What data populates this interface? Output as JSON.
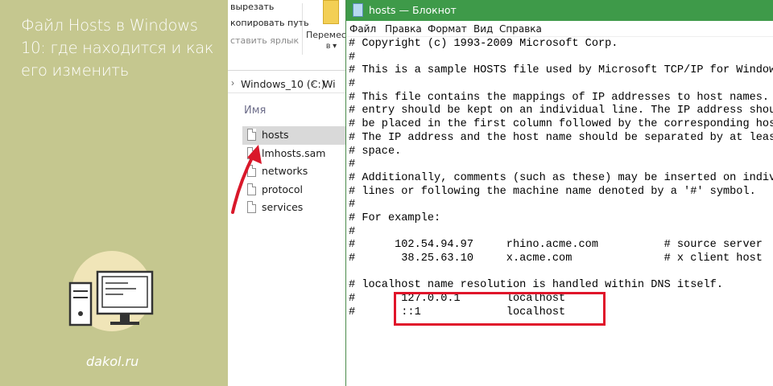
{
  "banner": {
    "title": "Файл Hosts в Windows 10: где находится и как его изменить",
    "site": "dakol.ru"
  },
  "explorer": {
    "ribbon": {
      "cut_label": "вырезать",
      "copy_path_label": "копировать путь",
      "paste_shortcut_label": "ставить ярлык",
      "move_label": "Перемест",
      "move_sub": "в ▾"
    },
    "address": {
      "segment1": "Windows_10 (C:)",
      "segment2": "Wi"
    },
    "column_header": "Имя",
    "files": [
      {
        "name": "hosts",
        "selected": true
      },
      {
        "name": "lmhosts.sam",
        "selected": false
      },
      {
        "name": "networks",
        "selected": false
      },
      {
        "name": "protocol",
        "selected": false
      },
      {
        "name": "services",
        "selected": false
      }
    ]
  },
  "notepad": {
    "title": "hosts — Блокнот",
    "menu": [
      "Файл",
      "Правка",
      "Формат",
      "Вид",
      "Справка"
    ],
    "lines": [
      "# Copyright (c) 1993-2009 Microsoft Corp.",
      "#",
      "# This is a sample HOSTS file used by Microsoft TCP/IP for Windows.",
      "#",
      "# This file contains the mappings of IP addresses to host names. Each",
      "# entry should be kept on an individual line. The IP address should",
      "# be placed in the first column followed by the corresponding host name.",
      "# The IP address and the host name should be separated by at least one",
      "# space.",
      "#",
      "# Additionally, comments (such as these) may be inserted on individual",
      "# lines or following the machine name denoted by a '#' symbol.",
      "#",
      "# For example:",
      "#",
      "#      102.54.94.97     rhino.acme.com          # source server",
      "#       38.25.63.10     x.acme.com              # x client host",
      "",
      "# localhost name resolution is handled within DNS itself.",
      "#       127.0.0.1       localhost",
      "#       ::1             localhost"
    ]
  },
  "colors": {
    "banner_bg": "#c5c78f",
    "titlebar": "#3e9a49",
    "highlight": "#e0142a"
  }
}
